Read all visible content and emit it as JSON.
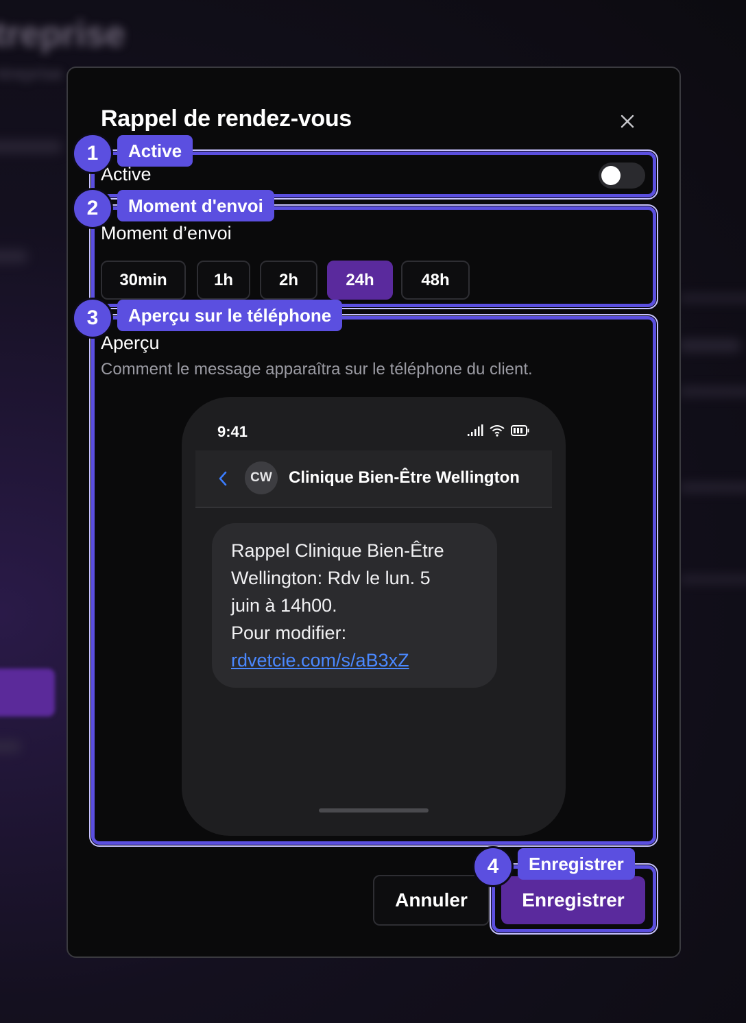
{
  "modal": {
    "title": "Rappel de rendez-vous"
  },
  "active": {
    "label": "Active",
    "enabled": false
  },
  "send_time": {
    "label": "Moment d’envoi",
    "options": [
      "30min",
      "1h",
      "2h",
      "24h",
      "48h"
    ],
    "selected": "24h"
  },
  "preview": {
    "label": "Aperçu",
    "description": "Comment le message apparaîtra sur le téléphone du client.",
    "phone": {
      "time": "9:41",
      "contact_initials": "CW",
      "contact_name": "Clinique Bien-Être Wellington",
      "message_lines": [
        "Rappel Clinique Bien-Être",
        "Wellington: Rdv le lun. 5",
        "juin à 14h00.",
        "Pour modifier:"
      ],
      "message_link": "rdvetcie.com/s/aB3xZ"
    }
  },
  "footer": {
    "cancel_label": "Annuler",
    "save_label": "Enregistrer"
  },
  "annotations": [
    {
      "number": "1",
      "label": "Active"
    },
    {
      "number": "2",
      "label": "Moment d'envoi"
    },
    {
      "number": "3",
      "label": "Aperçu sur le téléphone"
    },
    {
      "number": "4",
      "label": "Enregistrer"
    }
  ],
  "background": {
    "title": "ntreprise",
    "subtitle": "ntreprise"
  },
  "colors": {
    "accent": "#5a2a9d",
    "annotation": "#5b4fe0",
    "link": "#4a88ff"
  }
}
